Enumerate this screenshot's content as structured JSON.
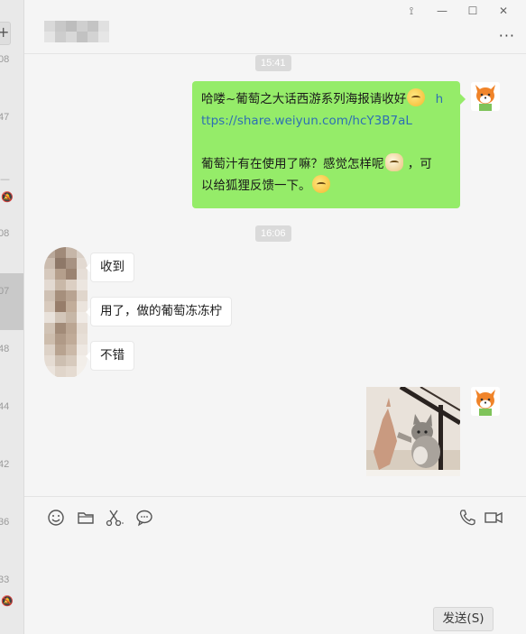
{
  "window": {
    "controls": {
      "pin": "⟟",
      "minimize": "—",
      "maximize": "☐",
      "close": "✕"
    },
    "more": "···"
  },
  "sidebar": {
    "add": "+",
    "times": [
      "08",
      "47",
      "08",
      "07",
      "48",
      "44",
      "42",
      "36",
      "33"
    ]
  },
  "chat": {
    "timestamps": [
      "15:41",
      "16:06"
    ],
    "outgoing_message": {
      "line1": "哈喽~葡萄之大话西游系列海报请收好",
      "link_part1": "h",
      "link_part2": "ttps://share.weiyun.com/hcY3B7aL",
      "line3a": "葡萄汁有在使用了嘛？感觉怎样呢",
      "line3b": "，可",
      "line4": "以给狐狸反馈一下。"
    },
    "incoming_messages": [
      "收到",
      "用了，做的葡萄冻冻柠",
      "不错"
    ]
  },
  "input": {
    "tools": [
      "emoji-icon",
      "folder-icon",
      "scissors-icon",
      "chat-history-icon",
      "phone-icon",
      "video-icon"
    ],
    "send_label": "发送(S)"
  },
  "colors": {
    "outgoing_bubble": "#95ec69",
    "incoming_bubble": "#ffffff",
    "link": "#2e6fb3",
    "background": "#f5f5f5"
  }
}
